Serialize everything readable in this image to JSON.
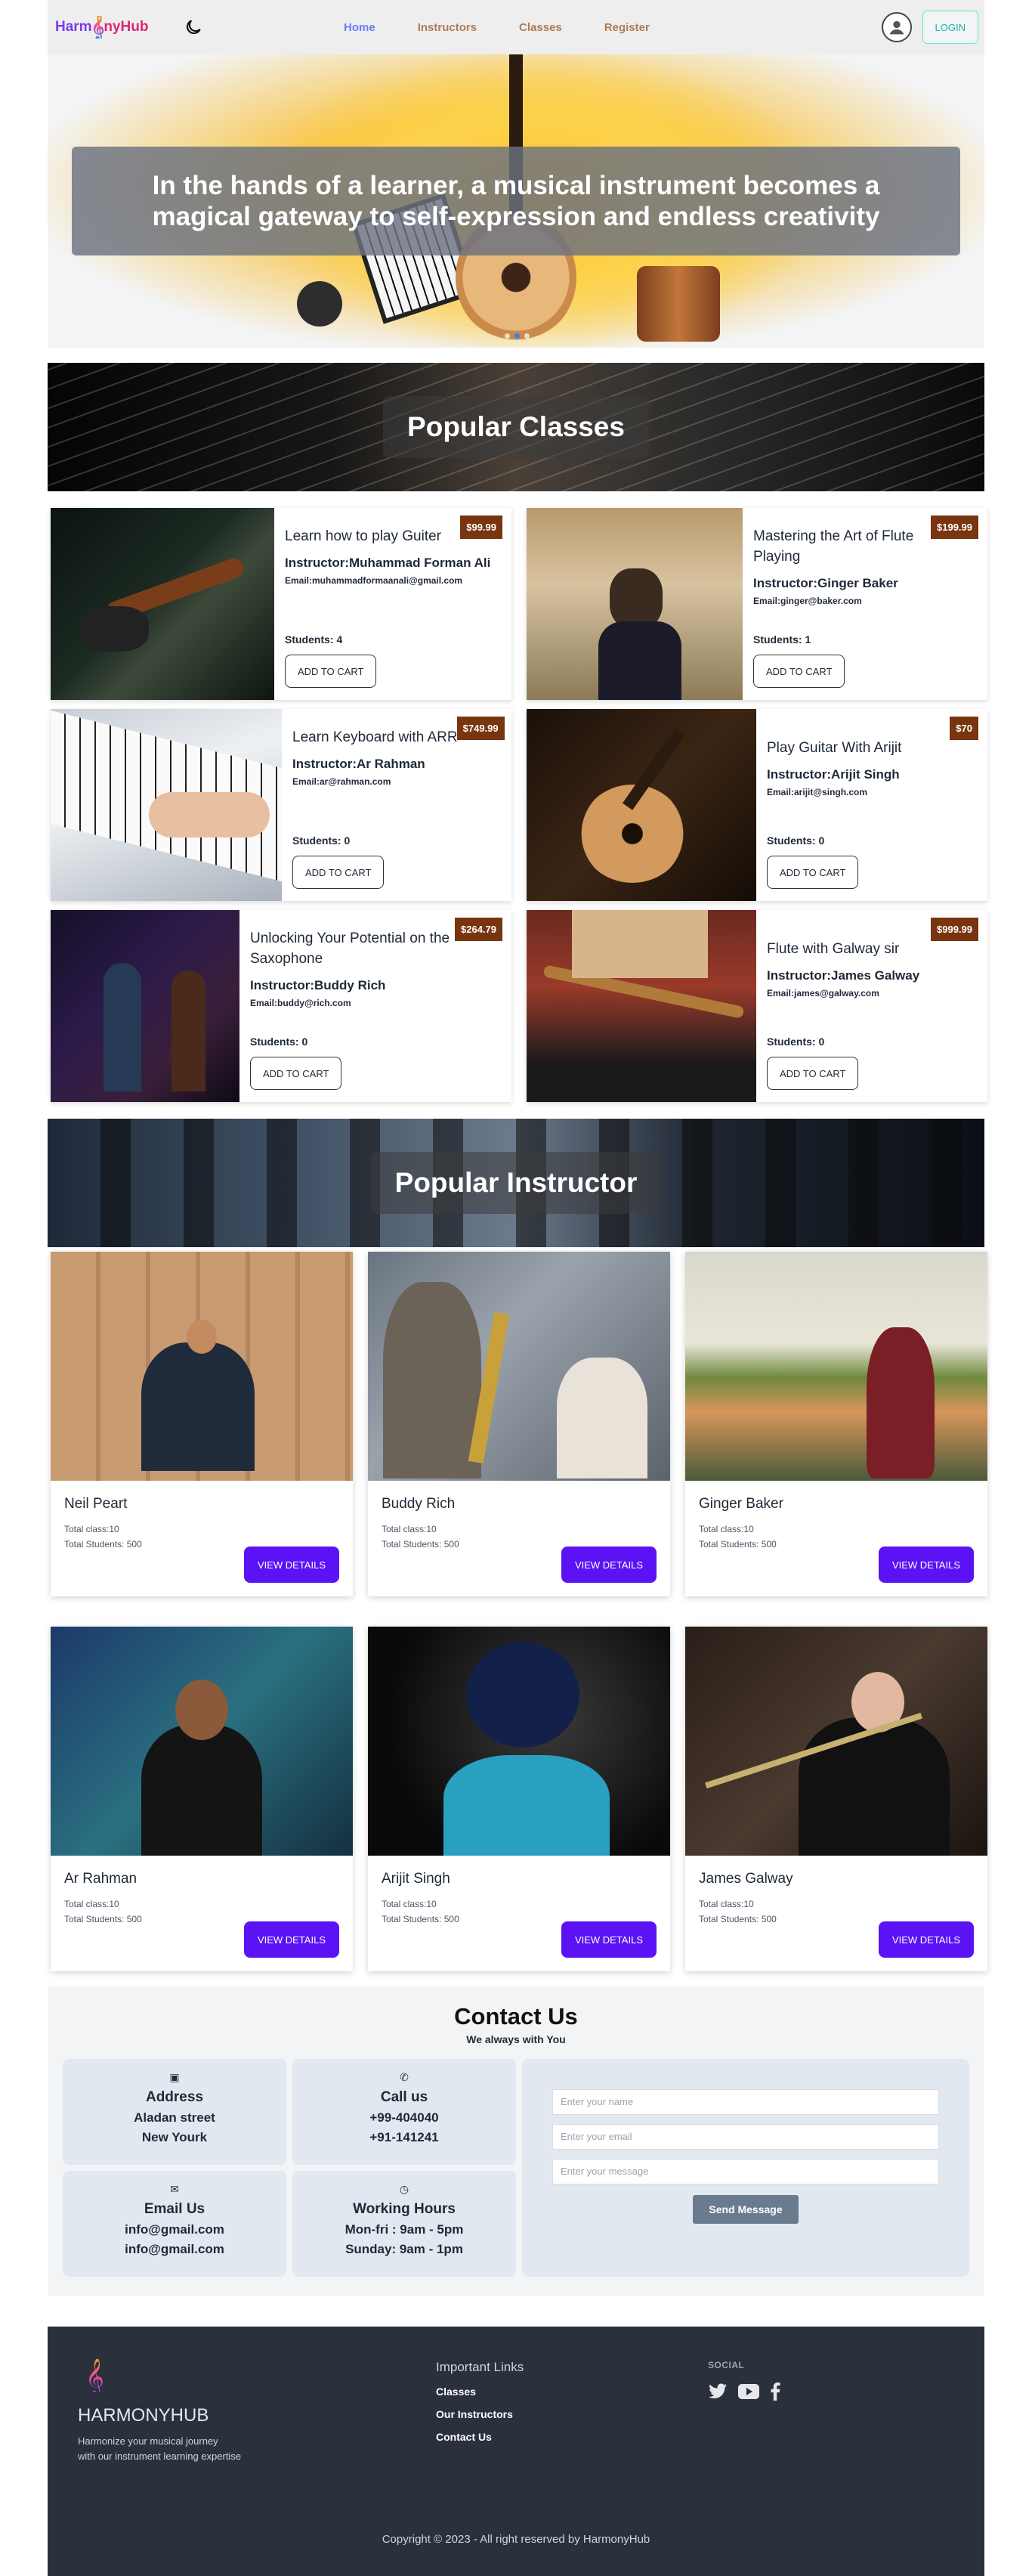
{
  "nav": {
    "logo_part1": "Harm",
    "logo_part2": "nyHub",
    "links": [
      {
        "label": "Home",
        "active": true
      },
      {
        "label": "Instructors",
        "active": false
      },
      {
        "label": "Classes",
        "active": false
      },
      {
        "label": "Register",
        "active": false
      }
    ],
    "login_label": "LOGIN",
    "icons": {
      "theme": "moon-icon",
      "user": "user-circle-icon"
    }
  },
  "hero": {
    "headline": "In the hands of a learner, a musical instrument becomes a magical gateway to self-expression and endless creativity",
    "slides": 3,
    "active_slide": 2
  },
  "popular_classes": {
    "title": "Popular Classes",
    "cards": [
      {
        "title": "Learn how to play Guiter",
        "instructor": "Instructor:Muhammad Forman Ali",
        "email": "Email:muhammadformaanali@gmail.com",
        "students": "Students: 4",
        "price": "$99.99",
        "button": "ADD TO CART"
      },
      {
        "title": "Mastering the Art of Flute Playing",
        "instructor": "Instructor:Ginger Baker",
        "email": "Email:ginger@baker.com",
        "students": "Students: 1",
        "price": "$199.99",
        "button": "ADD TO CART"
      },
      {
        "title": "Learn Keyboard with ARR",
        "instructor": "Instructor:Ar Rahman",
        "email": "Email:ar@rahman.com",
        "students": "Students: 0",
        "price": "$749.99",
        "button": "ADD TO CART"
      },
      {
        "title": "Play Guitar With Arijit",
        "instructor": "Instructor:Arijit Singh",
        "email": "Email:arijit@singh.com",
        "students": "Students: 0",
        "price": "$70",
        "button": "ADD TO CART"
      },
      {
        "title": "Unlocking Your Potential on the Saxophone",
        "instructor": "Instructor:Buddy Rich",
        "email": "Email:buddy@rich.com",
        "students": "Students: 0",
        "price": "$264.79",
        "button": "ADD TO CART"
      },
      {
        "title": "Flute with Galway sir",
        "instructor": "Instructor:James Galway",
        "email": "Email:james@galway.com",
        "students": "Students: 0",
        "price": "$999.99",
        "button": "ADD TO CART"
      }
    ]
  },
  "popular_instructor": {
    "title": "Popular Instructor",
    "cards": [
      {
        "name": "Neil Peart",
        "classes": "Total class:10",
        "students": "Total Students: 500",
        "button": "VIEW DETAILS"
      },
      {
        "name": "Buddy Rich",
        "classes": "Total class:10",
        "students": "Total Students: 500",
        "button": "VIEW DETAILS"
      },
      {
        "name": "Ginger Baker",
        "classes": "Total class:10",
        "students": "Total Students: 500",
        "button": "VIEW DETAILS"
      },
      {
        "name": "Ar Rahman",
        "classes": "Total class:10",
        "students": "Total Students: 500",
        "button": "VIEW DETAILS"
      },
      {
        "name": "Arijit Singh",
        "classes": "Total class:10",
        "students": "Total Students: 500",
        "button": "VIEW DETAILS"
      },
      {
        "name": "James Galway",
        "classes": "Total class:10",
        "students": "Total Students: 500",
        "button": "VIEW DETAILS"
      }
    ]
  },
  "contact": {
    "title": "Contact Us",
    "subtitle": "We always with You",
    "info": [
      {
        "icon": "address-card-icon",
        "title": "Address",
        "line1": "Aladan street",
        "line2": "New Yourk"
      },
      {
        "icon": "phone-icon",
        "title": "Call us",
        "line1": "+99-404040",
        "line2": "+91-141241"
      },
      {
        "icon": "envelope-icon",
        "title": "Email Us",
        "line1": "info@gmail.com",
        "line2": "info@gmail.com"
      },
      {
        "icon": "clock-icon",
        "title": "Working Hours",
        "line1": "Mon-fri : 9am - 5pm",
        "line2": "Sunday: 9am - 1pm"
      }
    ],
    "form": {
      "name_placeholder": "Enter your name",
      "email_placeholder": "Enter your email",
      "message_placeholder": "Enter your message",
      "send_label": "Send Message"
    }
  },
  "footer": {
    "brand": "HARMONYHUB",
    "desc_line1": "Harmonize your musical journey",
    "desc_line2": "with our instrument learning expertise",
    "links_title": "Important Links",
    "links": [
      "Classes",
      "Our Instructors",
      "Contact Us"
    ],
    "social_title": "SOCIAL",
    "social_icons": [
      "twitter-icon",
      "youtube-icon",
      "facebook-icon"
    ],
    "copyright": "Copyright © 2023 - All right reserved by HarmonyHub"
  },
  "colors": {
    "accent_purple": "#5b12f4",
    "price_badge": "#78350f",
    "nav_active": "#6b7cf7",
    "nav_link": "#b07b54",
    "footer_bg": "#2a303c"
  }
}
